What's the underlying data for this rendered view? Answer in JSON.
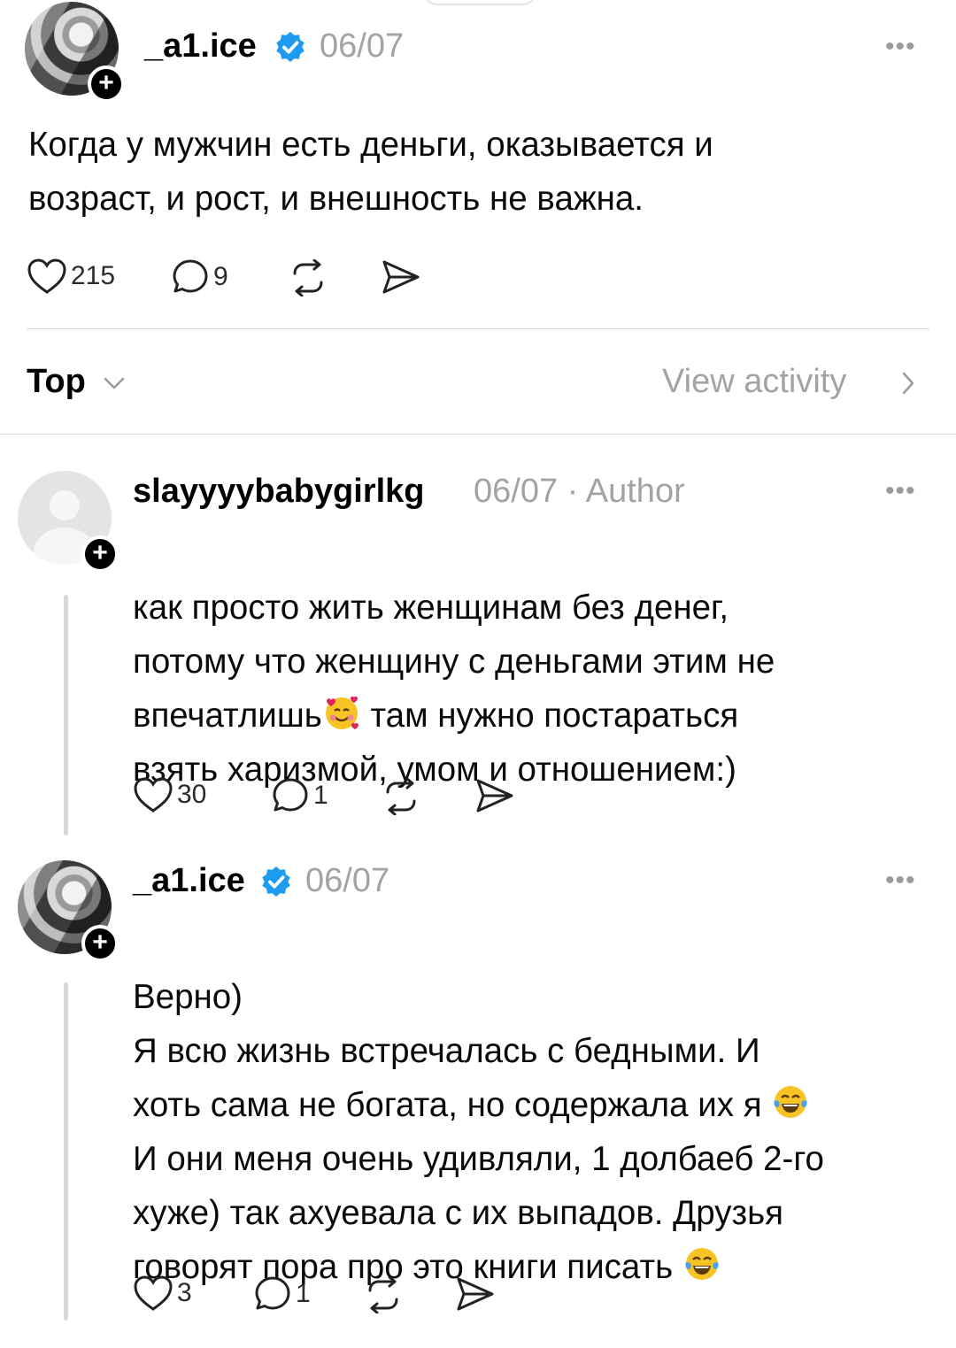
{
  "post": {
    "username": "_a1.ice",
    "date": "06/07",
    "text": "Когда у мужчин есть деньги, оказывается и\nвозраст, и рост, и внешность не важна.",
    "likes": "215",
    "replies": "9"
  },
  "sort": {
    "label": "Top",
    "view_activity": "View activity"
  },
  "replies": [
    {
      "username": "slayyyybabygirlkg",
      "date": "06/07",
      "author_tag": "· Author",
      "text_lines": [
        "как просто жить женщинам без денег,",
        "потому что женщину с деньгами этим не",
        "впечатлишь",
        " там нужно постараться",
        "взять харизмой, умом и отношением:)"
      ],
      "likes": "30",
      "replies": "1"
    },
    {
      "username": "_a1.ice",
      "date": "06/07",
      "text_lines": [
        "Верно)",
        "Я всю жизнь встречалась с бедными. И",
        "хоть сама не богата, но содержала их я ",
        "И они меня очень удивляли, 1 долбаеб 2-го",
        "хуже) так ахуевала с их выпадов. Друзья",
        "говорят пора про это книги писать "
      ],
      "likes": "3",
      "replies": "1"
    }
  ],
  "colors": {
    "verified": "#1d9bf0",
    "muted": "#a3a3a3"
  },
  "icons": [
    "heart-icon",
    "comment-icon",
    "repost-icon",
    "share-icon",
    "verified-icon",
    "more-icon",
    "chevron-down-icon",
    "chevron-right-icon"
  ]
}
